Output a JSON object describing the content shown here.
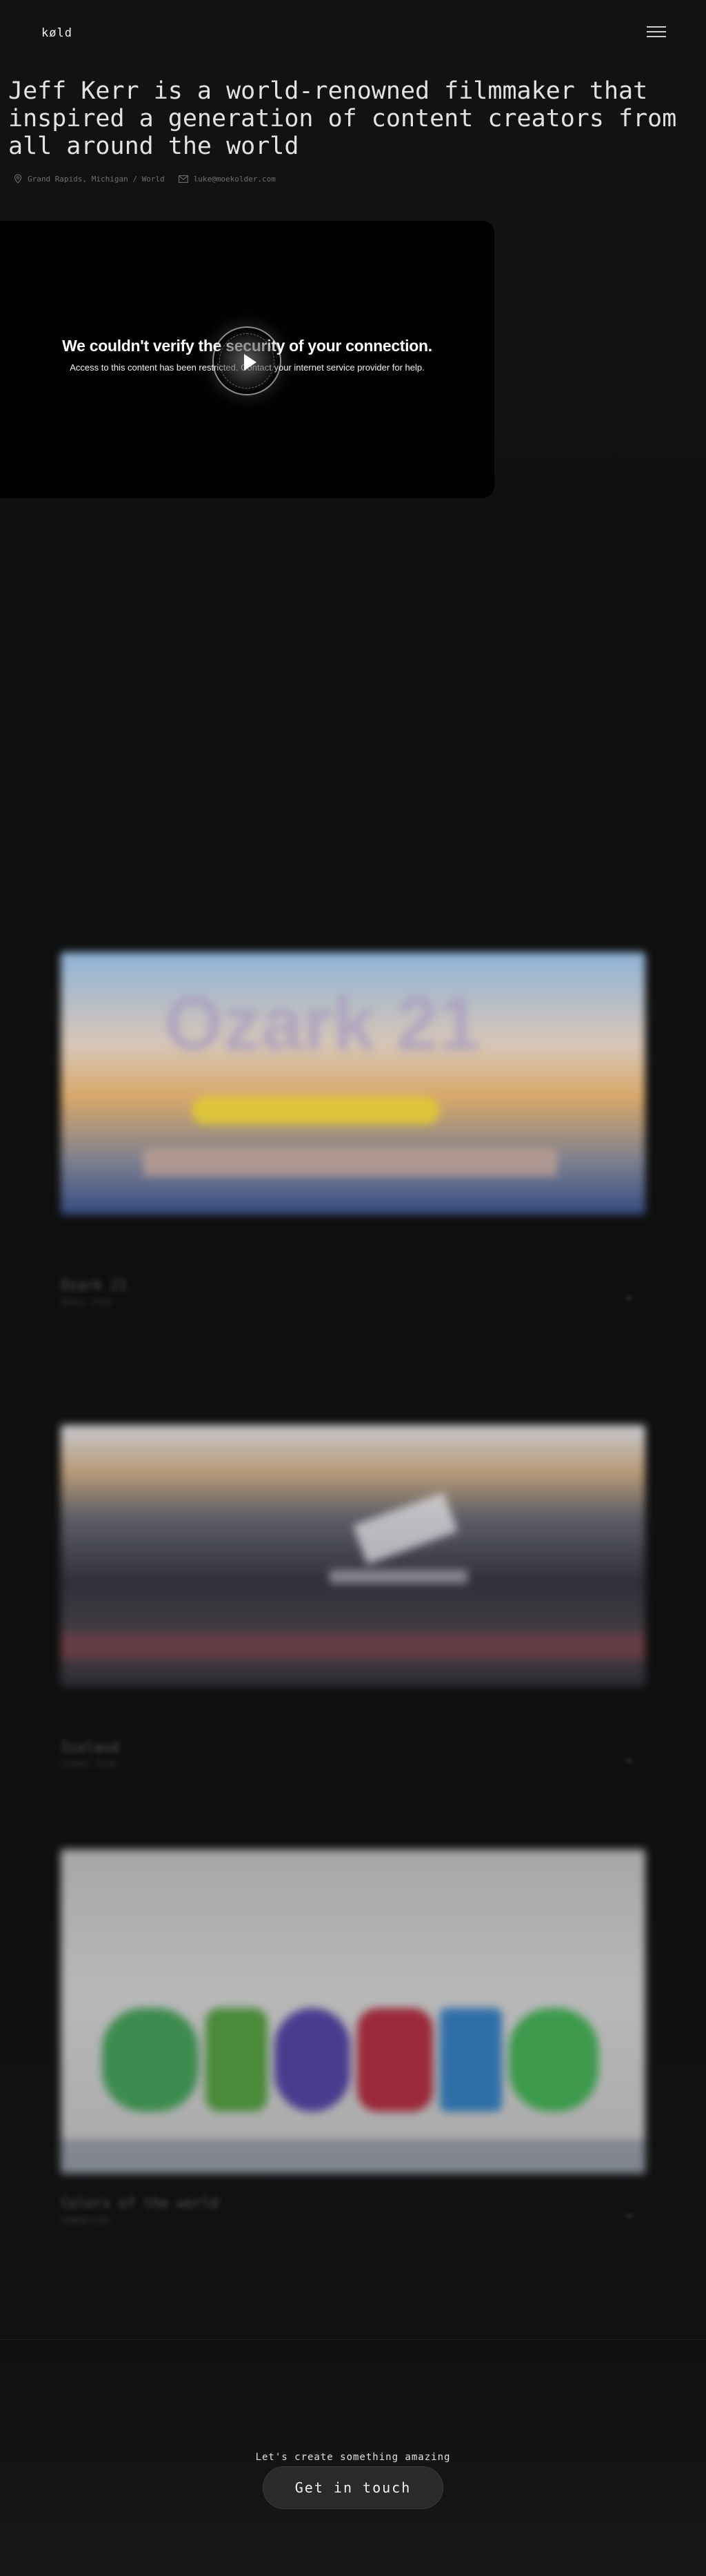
{
  "header": {
    "logo": "køld",
    "menu_icon": "hamburger-menu-icon"
  },
  "hero": {
    "title": "Jeff Kerr is a world-renowned filmmaker that inspired a generation of content creators from all around the world",
    "location": "Grand Rapids, Michigan / World",
    "email": "luke@moekolder.com",
    "location_icon": "map-pin-icon",
    "email_icon": "mail-icon"
  },
  "video": {
    "error_title": "We couldn't verify the security of your connection.",
    "error_message": "Access to this content has been restricted. Contact your internet service provider for help.",
    "play_icon": "play-icon"
  },
  "works": [
    {
      "title": "Ozark 21",
      "subtitle": "Short film",
      "thumb_text": "Ozark 21"
    },
    {
      "title": "Iceland",
      "subtitle": "Travel film"
    },
    {
      "title": "Colors of the world",
      "subtitle": "Commercial",
      "thumb_text": "colorYlo"
    }
  ],
  "cta": {
    "label": "Let's create something amazing",
    "button": "Get in touch"
  }
}
